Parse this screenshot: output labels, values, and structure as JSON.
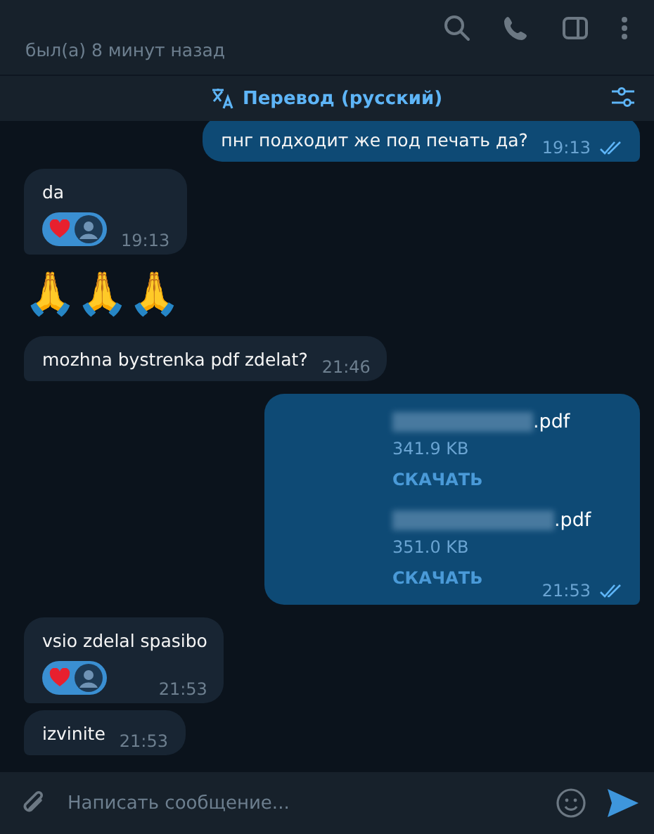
{
  "header": {
    "status": "был(а) 8 минут назад"
  },
  "translate_bar": {
    "label": "Перевод (русский)"
  },
  "messages": [
    {
      "kind": "text",
      "outgoing": true,
      "text": "пнг подходит же под печать да?",
      "time": "19:13",
      "read": true
    },
    {
      "kind": "text",
      "outgoing": false,
      "text": "da",
      "time": "19:13",
      "reactions": [
        {
          "kind": "heart",
          "chosen": true
        }
      ]
    },
    {
      "kind": "emoji",
      "text": "🙏🙏🙏"
    },
    {
      "kind": "text",
      "outgoing": false,
      "text": "mozhna bystrenka pdf zdelat?",
      "time": "21:46"
    },
    {
      "kind": "files",
      "outgoing": true,
      "time": "21:53",
      "read": true,
      "files": [
        {
          "name": ".pdf",
          "size": "341.9 KB",
          "action": "СКАЧАТЬ"
        },
        {
          "name": ".pdf",
          "size": "351.0 KB",
          "action": "СКАЧАТЬ"
        }
      ]
    },
    {
      "kind": "text",
      "outgoing": false,
      "text": "vsio zdelal spasibo",
      "time": "21:53",
      "reactions": [
        {
          "kind": "heart",
          "chosen": true
        }
      ]
    },
    {
      "kind": "text",
      "outgoing": false,
      "text": "izvinite",
      "time": "21:53"
    }
  ],
  "composer": {
    "placeholder": "Написать сообщение..."
  }
}
